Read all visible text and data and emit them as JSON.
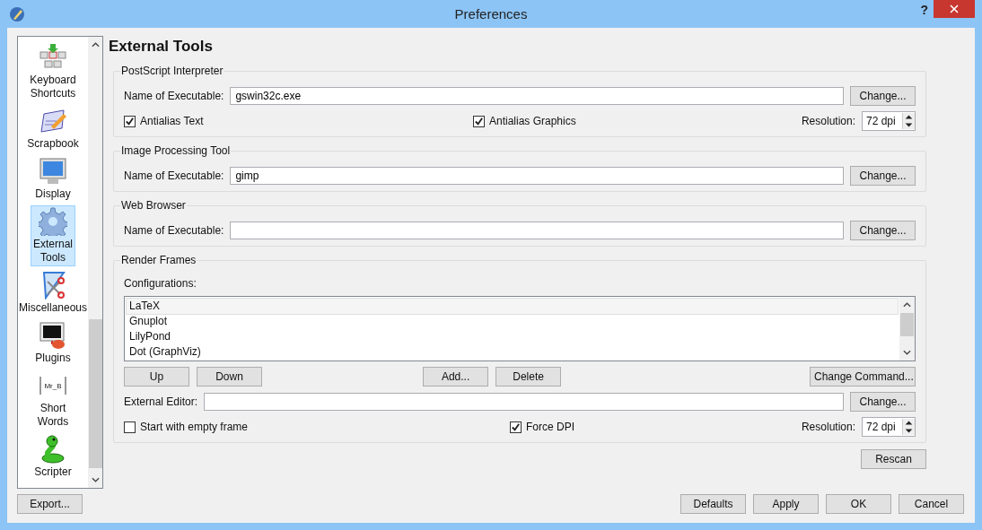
{
  "window": {
    "title": "Preferences",
    "help": "?"
  },
  "sidebar": {
    "items": [
      {
        "label": "Keyboard Shortcuts",
        "selected": false
      },
      {
        "label": "Scrapbook",
        "selected": false
      },
      {
        "label": "Display",
        "selected": false
      },
      {
        "label": "External Tools",
        "selected": true
      },
      {
        "label": "Miscellaneous",
        "selected": false
      },
      {
        "label": "Plugins",
        "selected": false
      },
      {
        "label": "Short Words",
        "selected": false,
        "icon_text": "Mr_B"
      },
      {
        "label": "Scripter",
        "selected": false
      }
    ]
  },
  "heading": "External Tools",
  "postscript": {
    "title": "PostScript Interpreter",
    "label": "Name of Executable:",
    "value": "gswin32c.exe",
    "button": "Change...",
    "checks": [
      {
        "label": "Antialias Text",
        "checked": true
      },
      {
        "label": "Antialias Graphics",
        "checked": true
      }
    ],
    "resolution_label": "Resolution:",
    "resolution": "72 dpi"
  },
  "image_tool": {
    "title": "Image Processing Tool",
    "label": "Name of Executable:",
    "value": "gimp",
    "button": "Change..."
  },
  "web_browser": {
    "title": "Web Browser",
    "label": "Name of Executable:",
    "button": "Change..."
  },
  "render_frames": {
    "title": "Render Frames",
    "configurations_label": "Configurations:",
    "configurations": [
      {
        "label": "LaTeX",
        "selected": true
      },
      {
        "label": "Gnuplot",
        "selected": false
      },
      {
        "label": "LilyPond",
        "selected": false
      },
      {
        "label": "Dot (GraphViz)",
        "selected": false
      }
    ],
    "move_buttons": [
      "Up",
      "Down"
    ],
    "edit_buttons": [
      "Add...",
      "Delete"
    ],
    "command_button": "Change Command...",
    "editor_label": "External Editor:",
    "editor_button": "Change...",
    "checks": [
      {
        "label": "Start with empty frame",
        "checked": false
      },
      {
        "label": "Force DPI",
        "checked": true
      }
    ],
    "resolution_label": "Resolution:",
    "resolution": "72 dpi"
  },
  "rescan": "Rescan",
  "footer": {
    "export": "Export...",
    "buttons": [
      "Defaults",
      "Apply",
      "OK",
      "Cancel"
    ]
  }
}
